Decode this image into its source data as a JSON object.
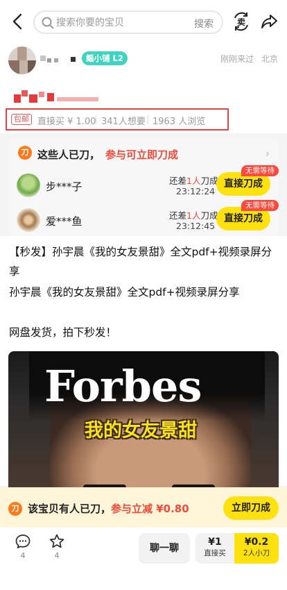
{
  "search": {
    "placeholder": "搜索你要的宝贝",
    "button_label": "搜索",
    "trade_icon_text": "卖"
  },
  "seller": {
    "badge_prefix": "鲻小铺",
    "badge_level": "L2",
    "last_visit": "刚刚来过",
    "location": "北京"
  },
  "item": {
    "masked_text": "2人小刀价",
    "free_shipping_tag": "包邮",
    "direct_buy": "直接买 ¥ 1.00",
    "wants": "341人想要",
    "views": "1963 人浏览"
  },
  "bargain": {
    "icon_text": "刀",
    "title": "这些人已刀，",
    "subtitle": "参与可立即刀成",
    "more_chevron": "›",
    "helpers": [
      {
        "name": "步***子",
        "need_prefix": "还差",
        "need_num": "1人",
        "need_suffix": "刀成",
        "time": "23:12:24",
        "button": "直接刀成",
        "tag": "无需等待"
      },
      {
        "name": "爱***鱼",
        "need_prefix": "还差",
        "need_num": "1人",
        "need_suffix": "刀成",
        "time": "23:12:45",
        "button": "直接刀成",
        "tag": "无需等待"
      }
    ]
  },
  "description": {
    "lines": [
      "【秒发】孙宇晨《我的女友景甜》全文pdf+视频录屏分",
      "享",
      "孙宇晨《我的女友景甜》全文pdf+视频录屏分享",
      "",
      "网盘发货，拍下秒发！"
    ]
  },
  "cover": {
    "headline": "Forbes",
    "caption": "我的女友景甜"
  },
  "promo": {
    "icon_text": "刀",
    "text_prefix": "该宝贝有人已刀，",
    "text_red": "参与立减 ¥0.80",
    "button": "立即刀成"
  },
  "actions": {
    "comment_count": "4",
    "favorite_count": "4",
    "chat_label": "聊一聊",
    "buy_price": "¥1",
    "buy_label": "直接买",
    "cut_price": "¥0.2",
    "cut_label": "2人小刀"
  },
  "colors": {
    "accent_yellow": "#ffe10e",
    "accent_red": "#f04a3a",
    "badge_teal": "#3fd3c0",
    "highlight_box": "#e34343"
  }
}
